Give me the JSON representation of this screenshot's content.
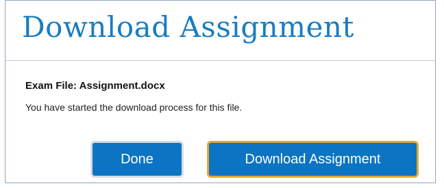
{
  "dialog": {
    "title": "Download Assignment",
    "file_label": "Exam File: Assignment.docx",
    "status_text": "You have started the download process for this file.",
    "buttons": {
      "done_label": "Done",
      "download_label": "Download Assignment"
    }
  },
  "colors": {
    "title": "#1a7cc0",
    "button_background": "#0c74c2",
    "download_button_border": "#e1a832",
    "done_button_border": "#d7dde4",
    "dialog_border": "#8fa4c4"
  }
}
